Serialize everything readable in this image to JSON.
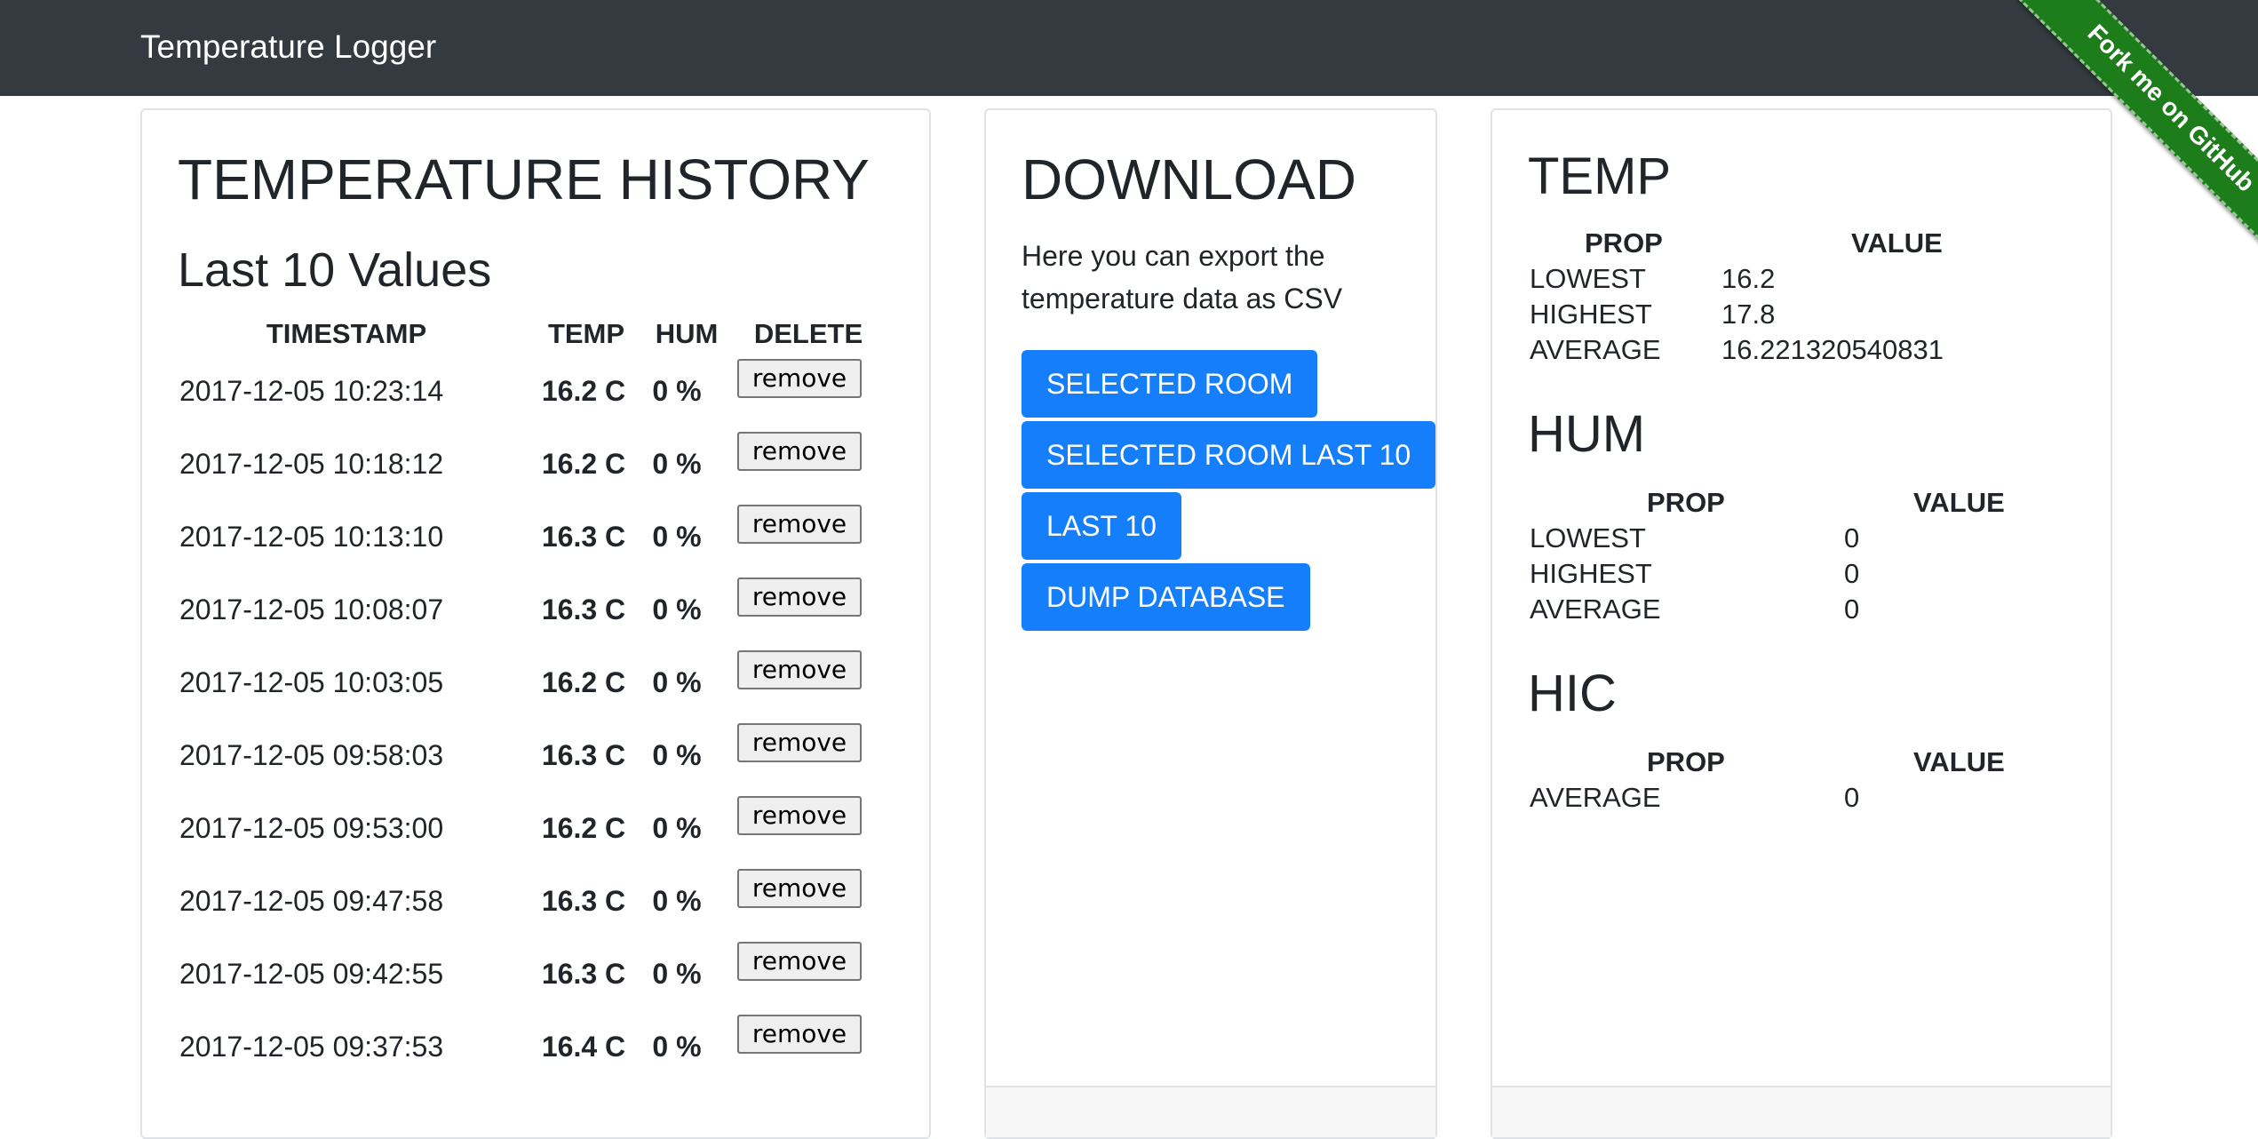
{
  "navbar": {
    "brand": "Temperature Logger"
  },
  "ribbon": {
    "label": "Fork me on GitHub"
  },
  "history": {
    "title": "TEMPERATURE HISTORY",
    "subtitle": "Last 10 Values",
    "headers": {
      "timestamp": "TIMESTAMP",
      "temp": "TEMP",
      "hum": "HUM",
      "delete": "DELETE"
    },
    "rows": [
      {
        "timestamp": "2017-12-05 10:23:14",
        "temp": "16.2 C",
        "hum": "0 %",
        "action": "remove"
      },
      {
        "timestamp": "2017-12-05 10:18:12",
        "temp": "16.2 C",
        "hum": "0 %",
        "action": "remove"
      },
      {
        "timestamp": "2017-12-05 10:13:10",
        "temp": "16.3 C",
        "hum": "0 %",
        "action": "remove"
      },
      {
        "timestamp": "2017-12-05 10:08:07",
        "temp": "16.3 C",
        "hum": "0 %",
        "action": "remove"
      },
      {
        "timestamp": "2017-12-05 10:03:05",
        "temp": "16.2 C",
        "hum": "0 %",
        "action": "remove"
      },
      {
        "timestamp": "2017-12-05 09:58:03",
        "temp": "16.3 C",
        "hum": "0 %",
        "action": "remove"
      },
      {
        "timestamp": "2017-12-05 09:53:00",
        "temp": "16.2 C",
        "hum": "0 %",
        "action": "remove"
      },
      {
        "timestamp": "2017-12-05 09:47:58",
        "temp": "16.3 C",
        "hum": "0 %",
        "action": "remove"
      },
      {
        "timestamp": "2017-12-05 09:42:55",
        "temp": "16.3 C",
        "hum": "0 %",
        "action": "remove"
      },
      {
        "timestamp": "2017-12-05 09:37:53",
        "temp": "16.4 C",
        "hum": "0 %",
        "action": "remove"
      }
    ]
  },
  "download": {
    "title": "DOWNLOAD",
    "description": "Here you can export the temperature data as CSV",
    "buttons": [
      {
        "label": "SELECTED ROOM"
      },
      {
        "label": "SELECTED ROOM LAST 10"
      },
      {
        "label": "LAST 10"
      },
      {
        "label": "DUMP DATABASE"
      }
    ]
  },
  "stats": {
    "temp": {
      "title": "TEMP",
      "prop_header": "PROP",
      "value_header": "VALUE",
      "rows": [
        {
          "prop": "LOWEST",
          "value": "16.2"
        },
        {
          "prop": "HIGHEST",
          "value": "17.8"
        },
        {
          "prop": "AVERAGE",
          "value": "16.221320540831"
        }
      ]
    },
    "hum": {
      "title": "HUM",
      "prop_header": "PROP",
      "value_header": "VALUE",
      "rows": [
        {
          "prop": "LOWEST",
          "value": "0"
        },
        {
          "prop": "HIGHEST",
          "value": "0"
        },
        {
          "prop": "AVERAGE",
          "value": "0"
        }
      ]
    },
    "hic": {
      "title": "HIC",
      "prop_header": "PROP",
      "value_header": "VALUE",
      "rows": [
        {
          "prop": "AVERAGE",
          "value": "0"
        }
      ]
    }
  },
  "colors": {
    "navbar": "#343a40",
    "primary_button": "#147efb",
    "ribbon": "#1d7d1a"
  }
}
